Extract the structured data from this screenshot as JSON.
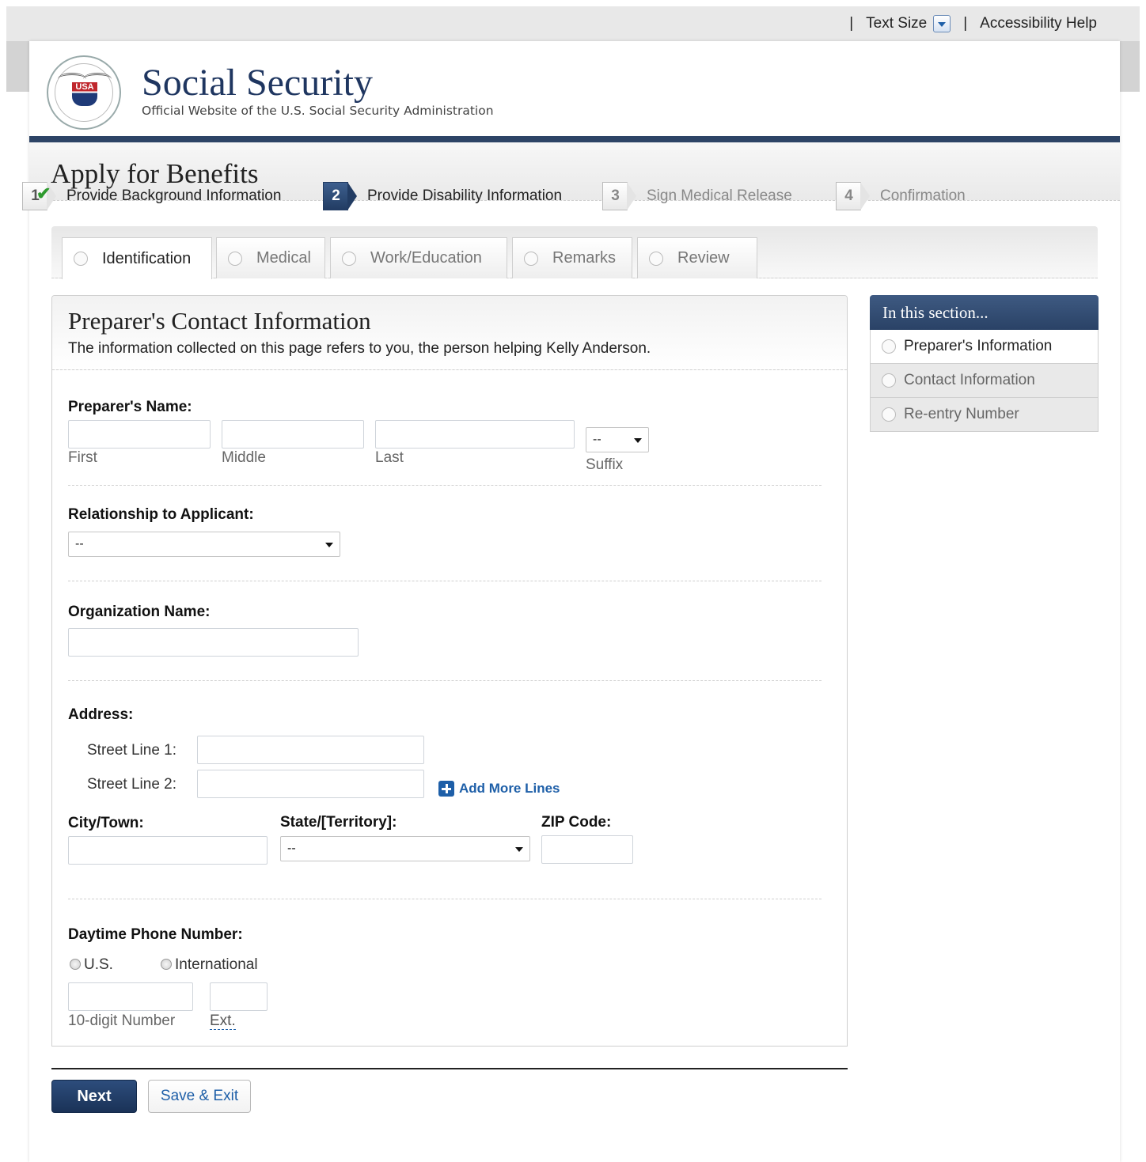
{
  "util": {
    "text_size": "Text Size",
    "accessibility": "Accessibility Help",
    "sep": "|"
  },
  "brand": {
    "title": "Social Security",
    "subtitle": "Official Website of the U.S. Social Security Administration",
    "seal_text": "USA"
  },
  "page_title": "Apply for Benefits",
  "steps": [
    {
      "num": "1",
      "label": "Provide Background Information",
      "state": "done"
    },
    {
      "num": "2",
      "label": "Provide Disability Information",
      "state": "active"
    },
    {
      "num": "3",
      "label": "Sign Medical Release",
      "state": "future"
    },
    {
      "num": "4",
      "label": "Confirmation",
      "state": "future"
    }
  ],
  "tabs": [
    {
      "label": "Identification",
      "active": true
    },
    {
      "label": "Medical",
      "active": false
    },
    {
      "label": "Work/Education",
      "active": false
    },
    {
      "label": "Remarks",
      "active": false
    },
    {
      "label": "Review",
      "active": false
    }
  ],
  "form": {
    "heading": "Preparer's Contact Information",
    "intro": "The information collected on this page refers to you, the person helping Kelly Anderson.",
    "name": {
      "label": "Preparer's Name:",
      "first": "First",
      "middle": "Middle",
      "last": "Last",
      "suffix": "Suffix",
      "suffix_value": "--"
    },
    "relationship": {
      "label": "Relationship to Applicant:",
      "value": "--"
    },
    "organization": {
      "label": "Organization Name:"
    },
    "address": {
      "label": "Address:",
      "street1": "Street Line 1:",
      "street2": "Street Line 2:",
      "add_more": "Add More Lines"
    },
    "city": {
      "label": "City/Town:"
    },
    "state": {
      "label": "State/[Territory]:",
      "value": "--"
    },
    "zip": {
      "label": "ZIP Code:"
    },
    "phone": {
      "label": "Daytime Phone Number:",
      "us": "U.S.",
      "intl": "International",
      "number": "10-digit Number",
      "ext": "Ext."
    }
  },
  "section_nav": {
    "title": "In this section...",
    "items": [
      {
        "label": "Preparer's Information",
        "current": true
      },
      {
        "label": "Contact Information",
        "current": false
      },
      {
        "label": "Re-entry Number",
        "current": false
      }
    ]
  },
  "actions": {
    "next": "Next",
    "save_exit": "Save & Exit"
  },
  "colors": {
    "navy": "#2d4466",
    "link": "#1e5fa8",
    "check": "#2e9a2e"
  }
}
